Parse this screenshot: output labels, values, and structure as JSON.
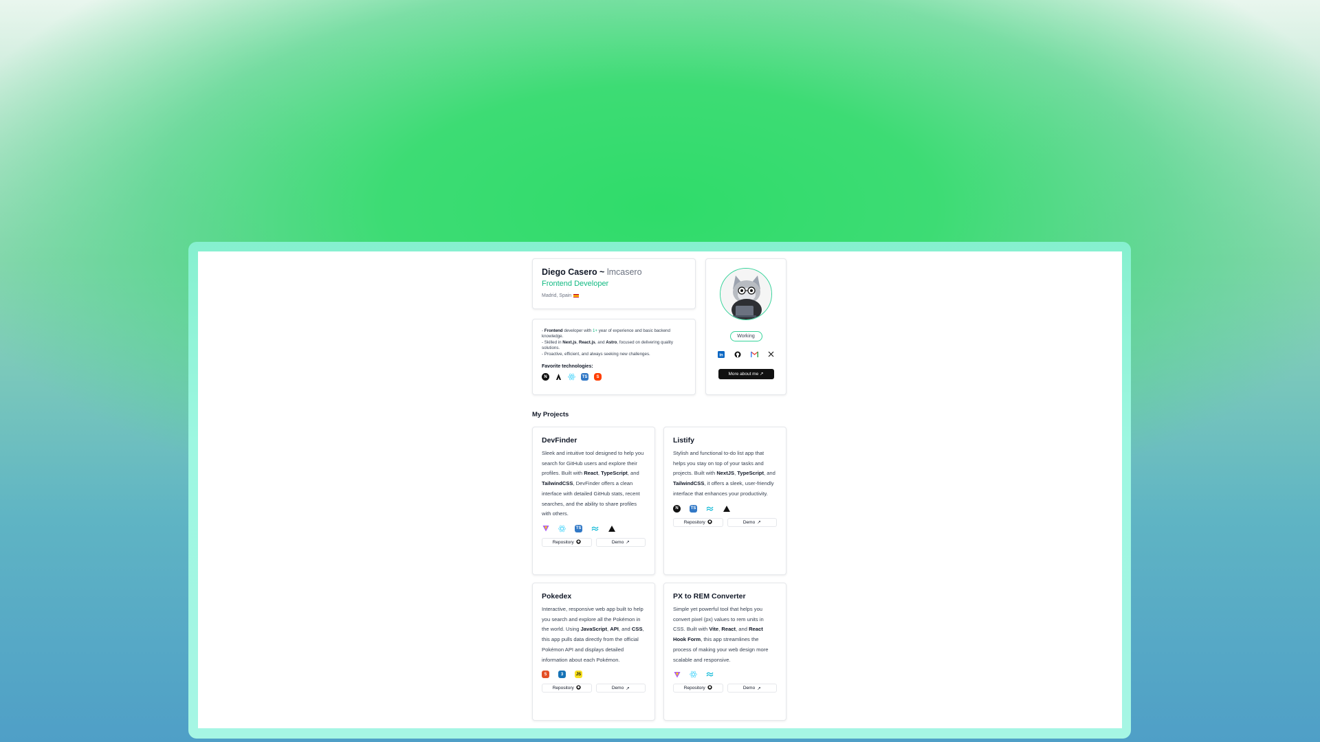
{
  "profile": {
    "name": "Diego Casero ~",
    "handle": "lmcasero",
    "role": "Frontend Developer",
    "location": "Madrid, Spain"
  },
  "bio": {
    "line1": {
      "pre": "- ",
      "b1": "Frontend",
      "mid1": " developer with ",
      "accent": "1+",
      "post": " year of experience and basic backend knowledge."
    },
    "line2": {
      "pre": "- Skilled in ",
      "b1": "Next.js",
      "sep1": ", ",
      "b2": "React.js",
      "sep2": ", and ",
      "b3": "Astro",
      "post": ", focused on delivering quality solutions."
    },
    "line3": "- Proactive, efficient, and always seeking new challenges.",
    "favorite_title": "Favorite technologies:",
    "favorite_icons": [
      "nextjs-icon",
      "astro-icon",
      "react-icon",
      "typescript-icon",
      "svelte-icon"
    ]
  },
  "sidebar": {
    "status": "Working",
    "socials": [
      "linkedin-icon",
      "github-icon",
      "gmail-icon",
      "x-icon"
    ],
    "more_button": "More about me"
  },
  "projects_title": "My Projects",
  "projects": [
    {
      "title": "DevFinder",
      "desc": [
        {
          "t": "Sleek and intuitive tool designed to help you search for GitHub users and explore their profiles. Built with "
        },
        {
          "b": "React"
        },
        {
          "t": ", "
        },
        {
          "b": "TypeScript"
        },
        {
          "t": ", and "
        },
        {
          "b": "TailwindCSS"
        },
        {
          "t": ", DevFinder offers a clean interface with detailed GitHub stats, recent searches, and the ability to share profiles with others."
        }
      ],
      "tech": [
        "vite-icon",
        "react-icon",
        "typescript-icon",
        "tailwind-icon",
        "vercel-icon"
      ],
      "repo": "Repository",
      "demo": "Demo"
    },
    {
      "title": "Listify",
      "desc": [
        {
          "t": "Stylish and functional to-do list app that helps you stay on top of your tasks and projects. Built with "
        },
        {
          "b": "NextJS"
        },
        {
          "t": ", "
        },
        {
          "b": "TypeScript"
        },
        {
          "t": ", and "
        },
        {
          "b": "TailwindCSS"
        },
        {
          "t": ", it offers a sleek, user-friendly interface that enhances your productivity."
        }
      ],
      "tech": [
        "nextjs-icon",
        "typescript-icon",
        "tailwind-icon",
        "vercel-icon"
      ],
      "repo": "Repository",
      "demo": "Demo"
    },
    {
      "title": "Pokedex",
      "desc": [
        {
          "t": "Interactive, responsive web app built to help you search and explore all the Pokémon in the world. Using "
        },
        {
          "b": "JavaScript"
        },
        {
          "t": ", "
        },
        {
          "b": "API"
        },
        {
          "t": ", and "
        },
        {
          "b": "CSS"
        },
        {
          "t": ", this app pulls data directly from the official Pokémon API and displays detailed information about each Pokémon."
        }
      ],
      "tech": [
        "html5-icon",
        "css3-icon",
        "javascript-icon"
      ],
      "repo": "Repository",
      "demo": "Demo"
    },
    {
      "title": "PX to REM Converter",
      "desc": [
        {
          "t": "Simple yet powerful tool that helps you convert pixel (px) values to rem units in CSS. Built with "
        },
        {
          "b": "Vite"
        },
        {
          "t": ", "
        },
        {
          "b": "React"
        },
        {
          "t": ", and "
        },
        {
          "b": "React Hook Form"
        },
        {
          "t": ", this app streamlines the process of making your web design more scalable and responsive."
        }
      ],
      "tech": [
        "vite-icon",
        "react-icon",
        "tailwind-icon"
      ],
      "repo": "Repository",
      "demo": "Demo"
    }
  ],
  "colors": {
    "accent": "#10b981",
    "brand_green": "#2fdc6a",
    "frame": "#9df7e1"
  }
}
